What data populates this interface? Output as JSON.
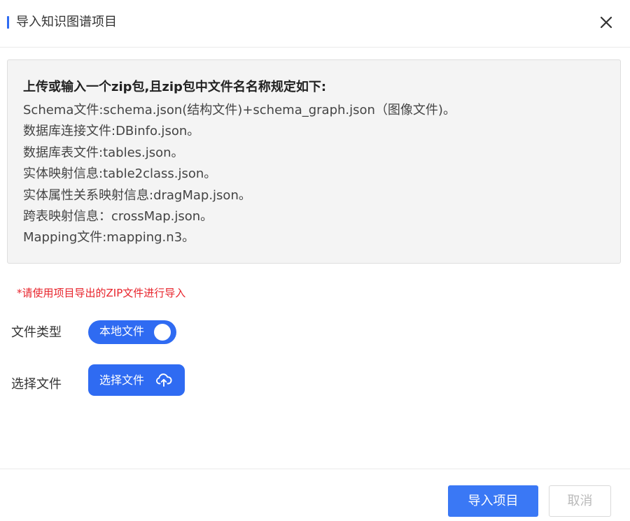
{
  "dialog": {
    "title": "导入知识图谱项目",
    "close_icon": "close-icon"
  },
  "info": {
    "heading": "上传或输入一个zip包,且zip包中文件名名称规定如下:",
    "lines": [
      "Schema文件:schema.json(结构文件)+schema_graph.json（图像文件)。",
      "数据库连接文件:DBinfo.json。",
      "数据库表文件:tables.json。",
      "实体映射信息:table2class.json。",
      "实体属性关系映射信息:dragMap.json。",
      "跨表映射信息：crossMap.json。",
      "Mapping文件:mapping.n3。"
    ]
  },
  "warning": "*请使用项目导出的ZIP文件进行导入",
  "form": {
    "file_type_label": "文件类型",
    "file_type_toggle": "本地文件",
    "select_file_label": "选择文件",
    "select_file_button": "选择文件",
    "upload_icon": "cloud-upload-icon"
  },
  "footer": {
    "import_button": "导入项目",
    "cancel_button": "取消"
  },
  "colors": {
    "accent": "#2f6bf2",
    "warning": "#e8242c",
    "info_bg": "#f4f4f4",
    "disabled_text": "#b9b9b9"
  }
}
